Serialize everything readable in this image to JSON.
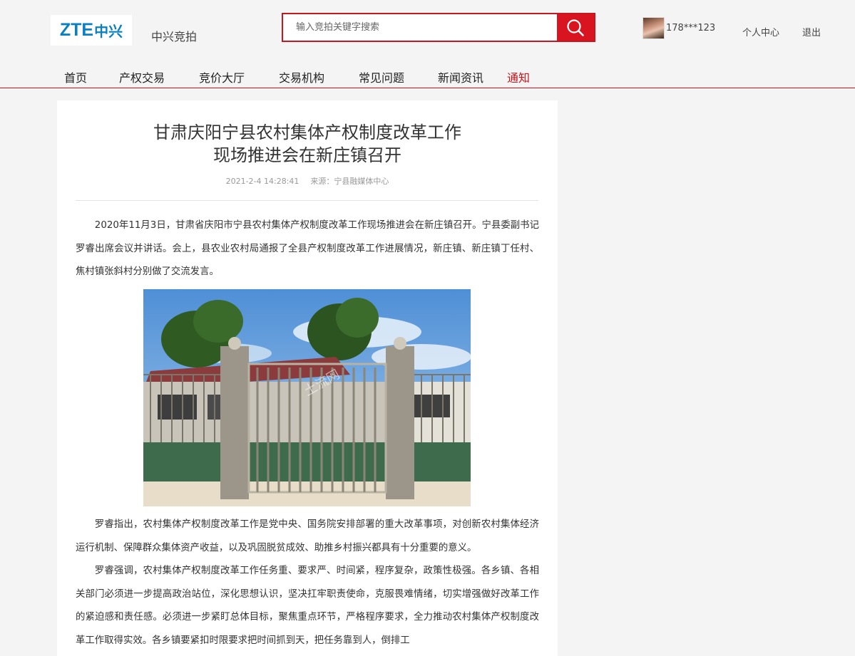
{
  "header": {
    "logo_latin": "ZTE",
    "logo_cn": "中兴",
    "site_name": "中兴竞拍",
    "search_placeholder": "输入竞拍关键字搜索",
    "username": "178***123",
    "personal_center": "个人中心",
    "logout": "退出"
  },
  "nav": {
    "items": [
      "首页",
      "产权交易",
      "竞价大厅",
      "交易机构",
      "常见问题",
      "新闻资讯",
      "通知"
    ],
    "active_index": 6
  },
  "article": {
    "title_line1": "甘肃庆阳宁县农村集体产权制度改革工作",
    "title_line2": "现场推进会在新庄镇召开",
    "datetime": "2021-2-4 14:28:41",
    "source": "来源：宁县融媒体中心",
    "paragraphs": [
      "2020年11月3日，甘肃省庆阳市宁县农村集体产权制度改革工作现场推进会在新庄镇召开。宁县委副书记罗睿出席会议并讲话。会上，县农业农村局通报了全县产权制度改革工作进展情况，新庄镇、新庄镇丁任村、焦村镇张斜村分别做了交流发言。",
      "罗睿指出，农村集体产权制度改革工作是党中央、国务院安排部署的重大改革事项，对创新农村集体经济运行机制、保障群众集体资产收益，以及巩固脱贫成效、助推乡村振兴都具有十分重要的意义。",
      "罗睿强调，农村集体产权制度改革工作任务重、要求严、时间紧，程序复杂，政策性极强。各乡镇、各相关部门必须进一步提高政治站位，深化思想认识，坚决扛牢职责使命，克服畏难情绪，切实增强做好改革工作的紧迫感和责任感。必须进一步紧盯总体目标，聚焦重点环节，严格程序要求，全力推动农村集体产权制度改革工作取得实效。各乡镇要紧扣时限要求把时间抓到天，把任务靠到人，倒排工"
    ],
    "photo_watermark": "土流网"
  },
  "colors": {
    "brand_red": "#c8161e",
    "logo_blue": "#0a7fc3",
    "page_bg": "#f4f4f4"
  },
  "icons": {
    "search": "search-icon",
    "avatar": "avatar"
  }
}
